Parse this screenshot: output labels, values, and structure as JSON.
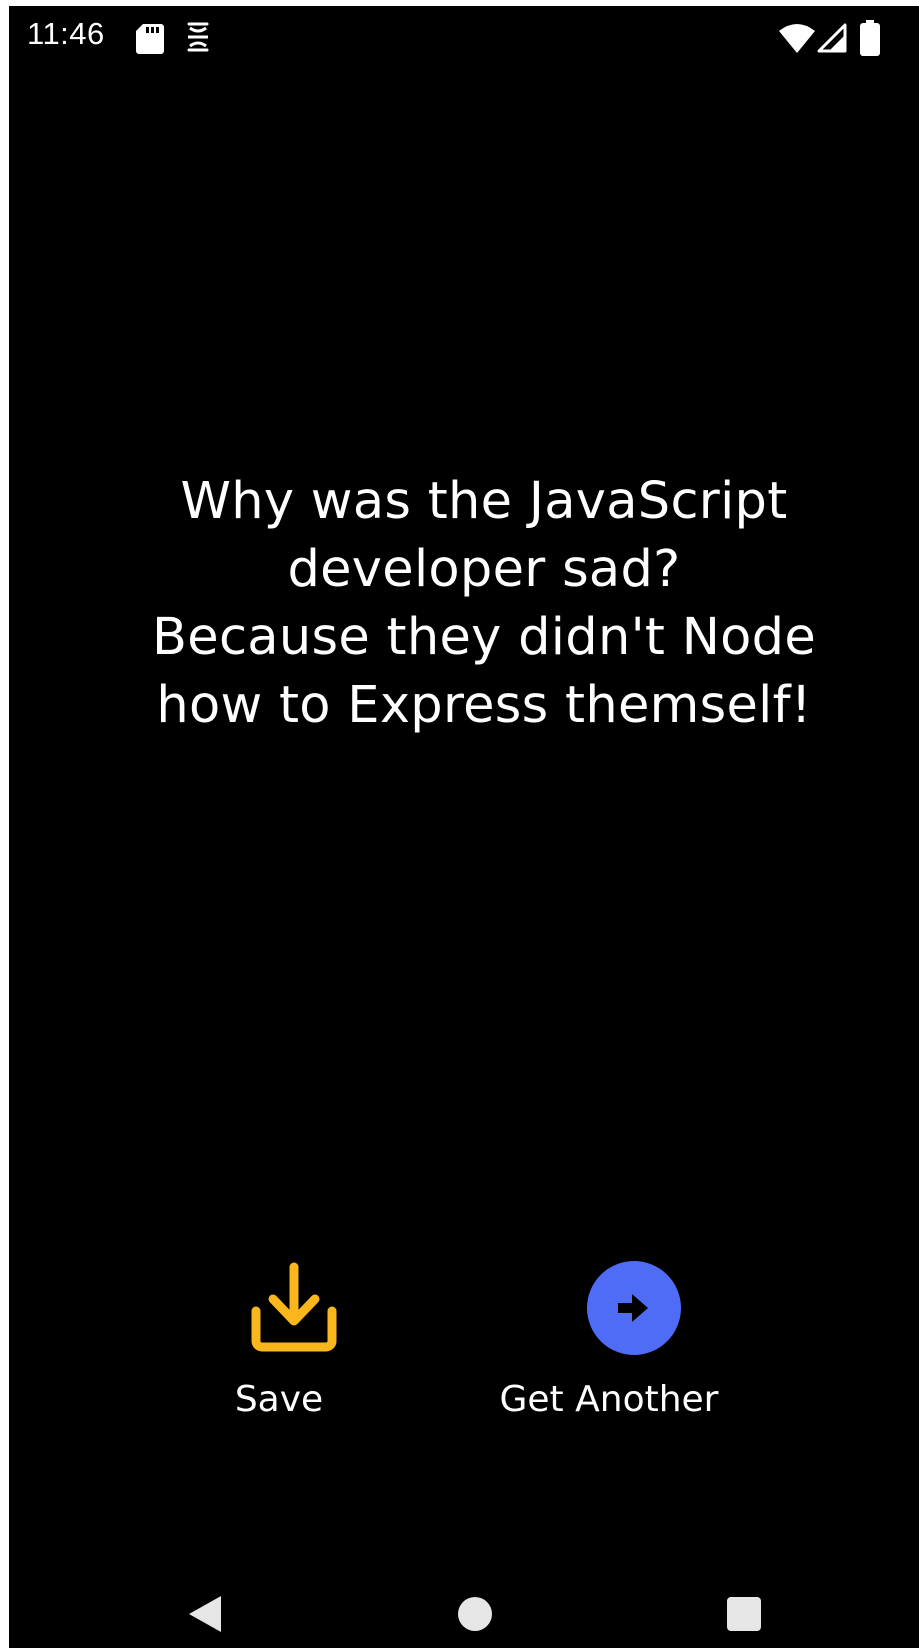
{
  "status_bar": {
    "time": "11:46",
    "icons": [
      "sd-card-icon",
      "notification-icon",
      "wifi-icon",
      "cell-signal-icon",
      "battery-icon"
    ]
  },
  "joke": {
    "text": "Why was the JavaScript\ndeveloper sad?\nBecause they didn't Node\nhow to Express themself!"
  },
  "actions": {
    "save_label": "Save",
    "get_another_label": "Get Another"
  },
  "colors": {
    "background": "#000000",
    "text": "#ffffff",
    "save_accent": "#f9b71c",
    "get_another_accent": "#4f6cf7"
  },
  "nav_bar": {
    "buttons": [
      "back-icon",
      "home-icon",
      "recents-icon"
    ]
  }
}
